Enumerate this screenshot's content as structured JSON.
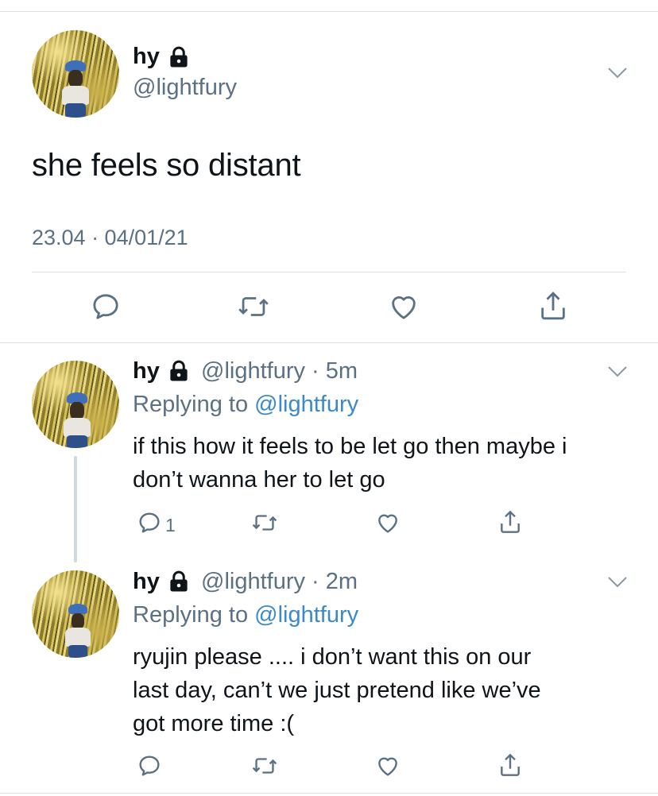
{
  "main_tweet": {
    "name": "hy",
    "handle": "@lightfury",
    "text": "she feels so distant",
    "timestamp": "23.04 · 04/01/21",
    "actions": [
      "reply-icon",
      "retweet-icon",
      "like-icon",
      "share-icon"
    ]
  },
  "replies": [
    {
      "name": "hy",
      "handle_time": "@lightfury · 5m",
      "replying_label": "Replying to ",
      "replying_to": "@lightfury",
      "text_lines": [
        "if this how it feels to be let go then maybe i",
        "don’t wanna her to let go"
      ],
      "reply_count": "1"
    },
    {
      "name": "hy",
      "handle_time": "@lightfury · 2m",
      "replying_label": "Replying to ",
      "replying_to": "@lightfury",
      "text_lines": [
        "ryujin please .... i don’t want this on our",
        "last day, can’t we just pretend like we’ve",
        "got more time :("
      ],
      "reply_count": ""
    }
  ],
  "colors": {
    "text": "#0f1419",
    "secondary": "#5b7083",
    "link": "#3b89c9",
    "divider": "#dcdfe2",
    "thread_line": "#cfd9de"
  }
}
